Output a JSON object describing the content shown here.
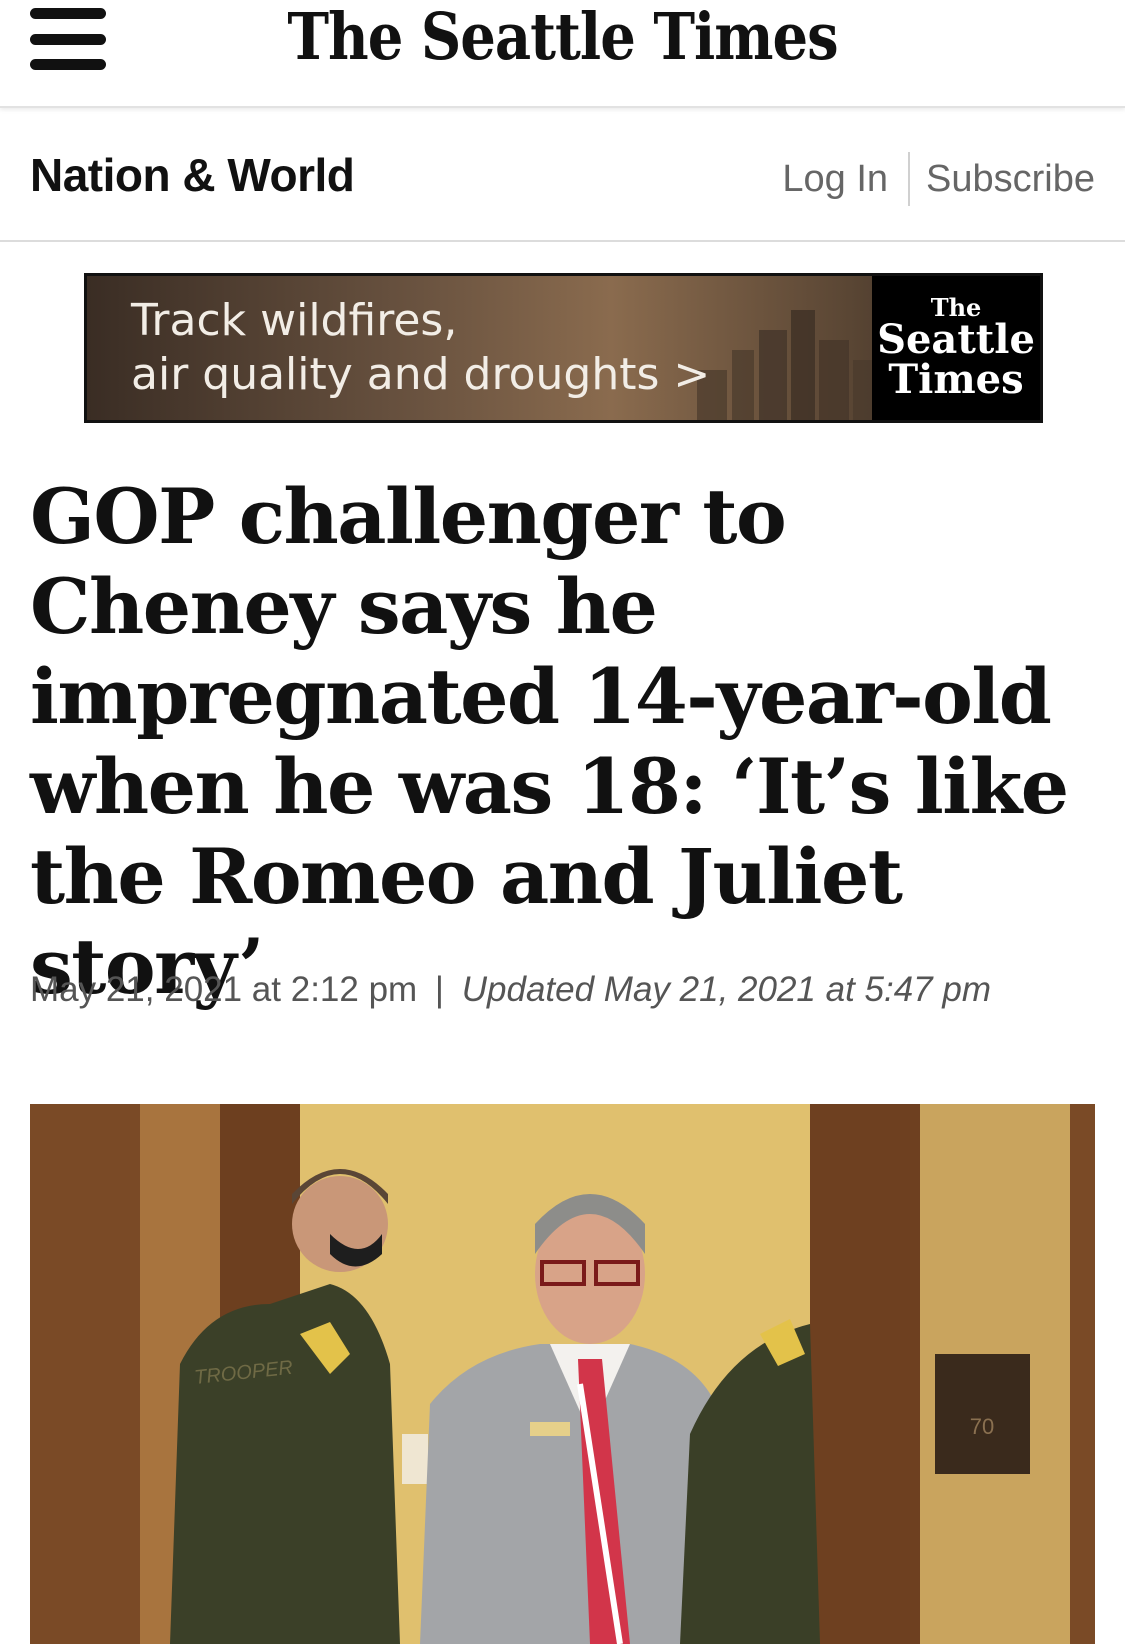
{
  "header": {
    "logo_text": "The Seattle Times",
    "menu_icon": "hamburger-menu-icon"
  },
  "section_bar": {
    "title": "Nation & World",
    "login_label": "Log In",
    "subscribe_label": "Subscribe"
  },
  "banner": {
    "line1": "Track wildfires,",
    "line2": "air quality and droughts >",
    "brand_line1": "The",
    "brand_line2": "Seattle",
    "brand_line3": "Times"
  },
  "article": {
    "headline": "GOP challenger to Cheney says he impregnated 14-year-old when he was 18: ‘It’s like the Romeo and Juliet story’",
    "published": "May 21, 2021 at 2:12 pm",
    "separator": "|",
    "updated": "Updated May 21, 2021 at 5:47 pm"
  },
  "photo": {
    "patch_text": "TROOPER",
    "sign_number": "70"
  },
  "colors": {
    "text": "#111111",
    "muted": "#666666",
    "banner_bg": "#6a5340",
    "photo_wall": "#d9b25a"
  }
}
